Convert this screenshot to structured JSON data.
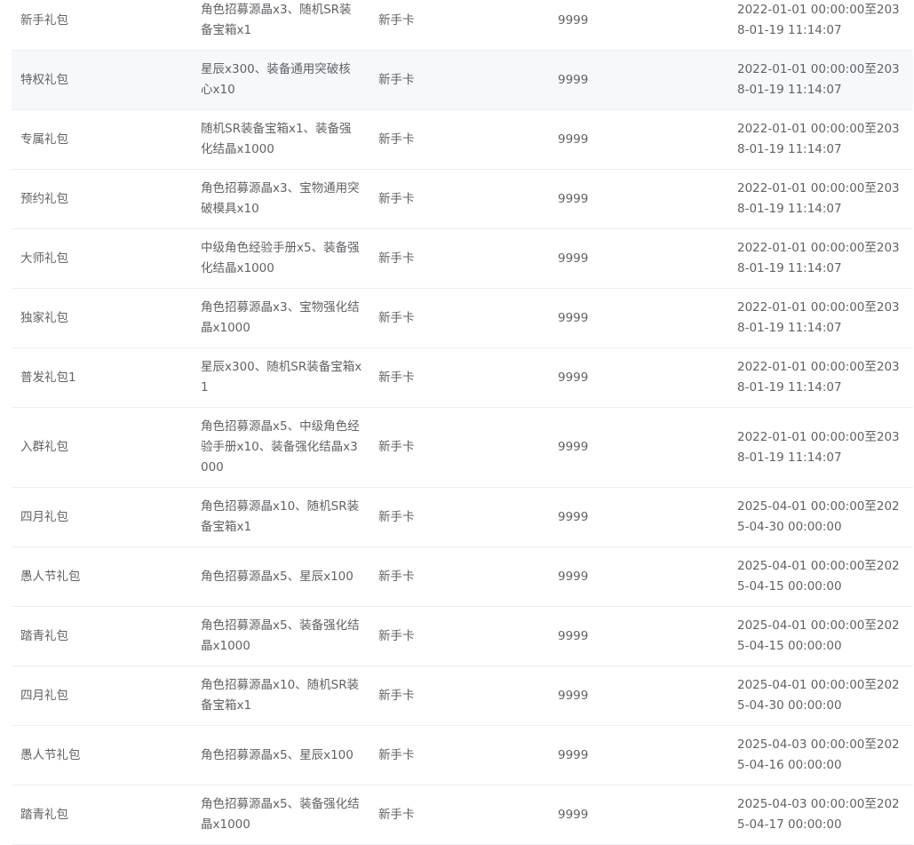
{
  "table": {
    "rows": [
      {
        "name": "新手礼包",
        "content": "角色招募源晶x3、随机SR装备宝箱x1",
        "card_type": "新手卡",
        "count": "9999",
        "time_range": "2022-01-01 00:00:00至2038-01-19 11:14:07"
      },
      {
        "name": "特权礼包",
        "content": "星辰x300、装备通用突破核心x10",
        "card_type": "新手卡",
        "count": "9999",
        "time_range": "2022-01-01 00:00:00至2038-01-19 11:14:07"
      },
      {
        "name": "专属礼包",
        "content": "随机SR装备宝箱x1、装备强化结晶x1000",
        "card_type": "新手卡",
        "count": "9999",
        "time_range": "2022-01-01 00:00:00至2038-01-19 11:14:07"
      },
      {
        "name": "预约礼包",
        "content": "角色招募源晶x3、宝物通用突破模具x10",
        "card_type": "新手卡",
        "count": "9999",
        "time_range": "2022-01-01 00:00:00至2038-01-19 11:14:07"
      },
      {
        "name": "大师礼包",
        "content": "中级角色经验手册x5、装备强化结晶x1000",
        "card_type": "新手卡",
        "count": "9999",
        "time_range": "2022-01-01 00:00:00至2038-01-19 11:14:07"
      },
      {
        "name": "独家礼包",
        "content": "角色招募源晶x3、宝物强化结晶x1000",
        "card_type": "新手卡",
        "count": "9999",
        "time_range": "2022-01-01 00:00:00至2038-01-19 11:14:07"
      },
      {
        "name": "普发礼包1",
        "content": "星辰x300、随机SR装备宝箱x1",
        "card_type": "新手卡",
        "count": "9999",
        "time_range": "2022-01-01 00:00:00至2038-01-19 11:14:07"
      },
      {
        "name": "入群礼包",
        "content": "角色招募源晶x5、中级角色经验手册x10、装备强化结晶x3000",
        "card_type": "新手卡",
        "count": "9999",
        "time_range": "2022-01-01 00:00:00至2038-01-19 11:14:07"
      },
      {
        "name": "四月礼包",
        "content": "角色招募源晶x10、随机SR装备宝箱x1",
        "card_type": "新手卡",
        "count": "9999",
        "time_range": "2025-04-01 00:00:00至2025-04-30 00:00:00"
      },
      {
        "name": "愚人节礼包",
        "content": "角色招募源晶x5、星辰x100",
        "card_type": "新手卡",
        "count": "9999",
        "time_range": "2025-04-01 00:00:00至2025-04-15 00:00:00"
      },
      {
        "name": "踏青礼包",
        "content": "角色招募源晶x5、装备强化结晶x1000",
        "card_type": "新手卡",
        "count": "9999",
        "time_range": "2025-04-01 00:00:00至2025-04-15 00:00:00"
      },
      {
        "name": "四月礼包",
        "content": "角色招募源晶x10、随机SR装备宝箱x1",
        "card_type": "新手卡",
        "count": "9999",
        "time_range": "2025-04-01 00:00:00至2025-04-30 00:00:00"
      },
      {
        "name": "愚人节礼包",
        "content": "角色招募源晶x5、星辰x100",
        "card_type": "新手卡",
        "count": "9999",
        "time_range": "2025-04-03 00:00:00至2025-04-16 00:00:00"
      },
      {
        "name": "踏青礼包",
        "content": "角色招募源晶x5、装备强化结晶x1000",
        "card_type": "新手卡",
        "count": "9999",
        "time_range": "2025-04-03 00:00:00至2025-04-17 00:00:00"
      }
    ]
  }
}
